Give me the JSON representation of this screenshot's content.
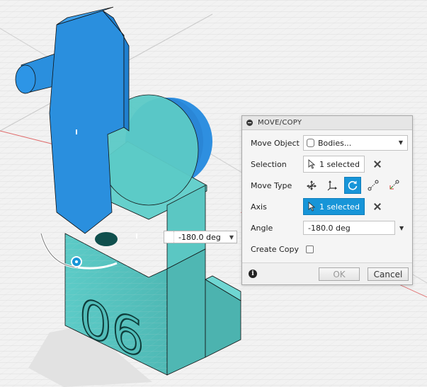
{
  "viewport": {
    "digits": "06",
    "angle_input": "-180.0 deg"
  },
  "dialog": {
    "title": "MOVE/COPY",
    "move_object": {
      "label": "Move Object",
      "value": "Bodies..."
    },
    "selection": {
      "label": "Selection",
      "value": "1 selected"
    },
    "move_type": {
      "label": "Move Type",
      "options": [
        "free-move-icon",
        "translate-icon",
        "rotate-icon",
        "point-to-point-icon",
        "point-to-position-icon"
      ],
      "active": "rotate-icon"
    },
    "axis": {
      "label": "Axis",
      "value": "1 selected"
    },
    "angle": {
      "label": "Angle",
      "value": "-180.0 deg"
    },
    "create_copy": {
      "label": "Create Copy",
      "checked": false
    },
    "ok_label": "OK",
    "cancel_label": "Cancel"
  },
  "colors": {
    "accent": "#1795d8",
    "body_blue": "#2a8fde",
    "body_teal": "#56c4c0"
  }
}
